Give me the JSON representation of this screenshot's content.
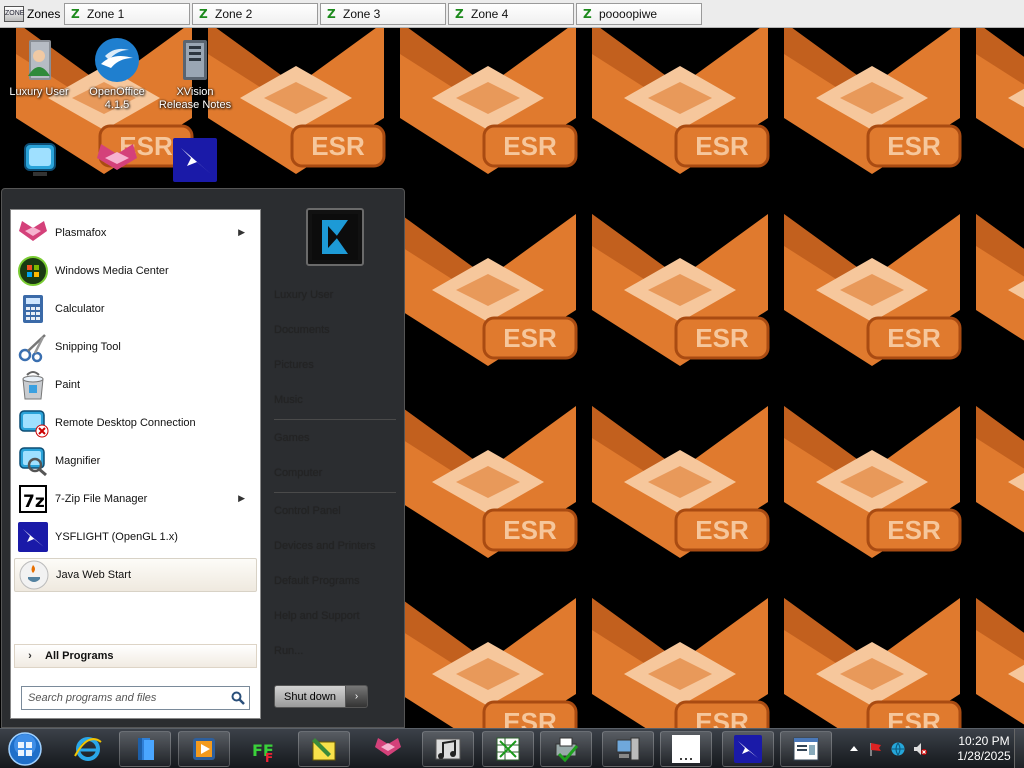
{
  "zones_bar": {
    "label": "Zones",
    "label_icon_text": "ZONE",
    "tabs": [
      {
        "label": "Zone 1"
      },
      {
        "label": "Zone 2"
      },
      {
        "label": "Zone 3"
      },
      {
        "label": "Zone 4"
      },
      {
        "label": "poooopiwe"
      }
    ],
    "tab_icon": "z-icon"
  },
  "wallpaper": {
    "tile_text": "ESR",
    "colors": {
      "background": "#000000",
      "orange": "#e07a2e",
      "light": "#f6c79c",
      "dark": "#a94b12"
    }
  },
  "desktop_icons": [
    {
      "label": "Luxury User",
      "icon": "user-folder-icon"
    },
    {
      "label": "OpenOffice 4.1.5",
      "icon": "openoffice-icon"
    },
    {
      "label": "XVision Release Notes",
      "icon": "notes-icon"
    },
    {
      "label": "",
      "icon": "remote-desktop-icon"
    },
    {
      "label": "",
      "icon": "plasmafox-icon"
    },
    {
      "label": "",
      "icon": "ysflight-icon"
    }
  ],
  "start_menu": {
    "programs": [
      {
        "label": "Plasmafox",
        "icon": "plasmafox-icon",
        "has_submenu": true
      },
      {
        "label": "Windows Media Center",
        "icon": "media-center-icon",
        "has_submenu": false
      },
      {
        "label": "Calculator",
        "icon": "calculator-icon",
        "has_submenu": false
      },
      {
        "label": "Snipping Tool",
        "icon": "scissors-icon",
        "has_submenu": false
      },
      {
        "label": "Paint",
        "icon": "paint-icon",
        "has_submenu": false
      },
      {
        "label": "Remote Desktop Connection",
        "icon": "remote-desktop-icon",
        "has_submenu": false
      },
      {
        "label": "Magnifier",
        "icon": "magnifier-icon",
        "has_submenu": false
      },
      {
        "label": "7-Zip File Manager",
        "icon": "seven-zip-icon",
        "has_submenu": true
      },
      {
        "label": "YSFLIGHT (OpenGL 1.x)",
        "icon": "ysflight-icon",
        "has_submenu": false
      },
      {
        "label": "Java Web Start",
        "icon": "java-icon",
        "has_submenu": false
      }
    ],
    "all_programs_label": "All Programs",
    "search_placeholder": "Search programs and files",
    "right_links": [
      "Luxury User",
      "Documents",
      "Pictures",
      "Music",
      "Games",
      "Computer",
      "Control Panel",
      "Devices and Printers",
      "Default Programs",
      "Help and Support",
      "Run..."
    ],
    "shutdown_label": "Shut down",
    "shutdown_arrow": "›",
    "submenu_arrow": "▶",
    "all_programs_arrow": "›"
  },
  "taskbar": {
    "pinned": [
      {
        "icon": "internet-explorer-icon"
      },
      {
        "icon": "file-explorer-icon"
      },
      {
        "icon": "media-player-icon"
      },
      {
        "icon": "fff-app-icon"
      },
      {
        "icon": "notepad-pencil-icon"
      },
      {
        "icon": "plasmafox-icon"
      },
      {
        "icon": "music-notes-icon"
      },
      {
        "icon": "spreadsheet-icon"
      },
      {
        "icon": "printer-check-icon"
      },
      {
        "icon": "computer-icon"
      },
      {
        "icon": "blank-window-icon"
      },
      {
        "icon": "ysflight-icon"
      },
      {
        "icon": "document-window-icon"
      }
    ],
    "tray": {
      "time": "10:20 PM",
      "date": "1/28/2025",
      "icons": [
        "show-hidden-arrow-icon",
        "flag-icon",
        "network-icon",
        "volume-icon"
      ]
    }
  }
}
